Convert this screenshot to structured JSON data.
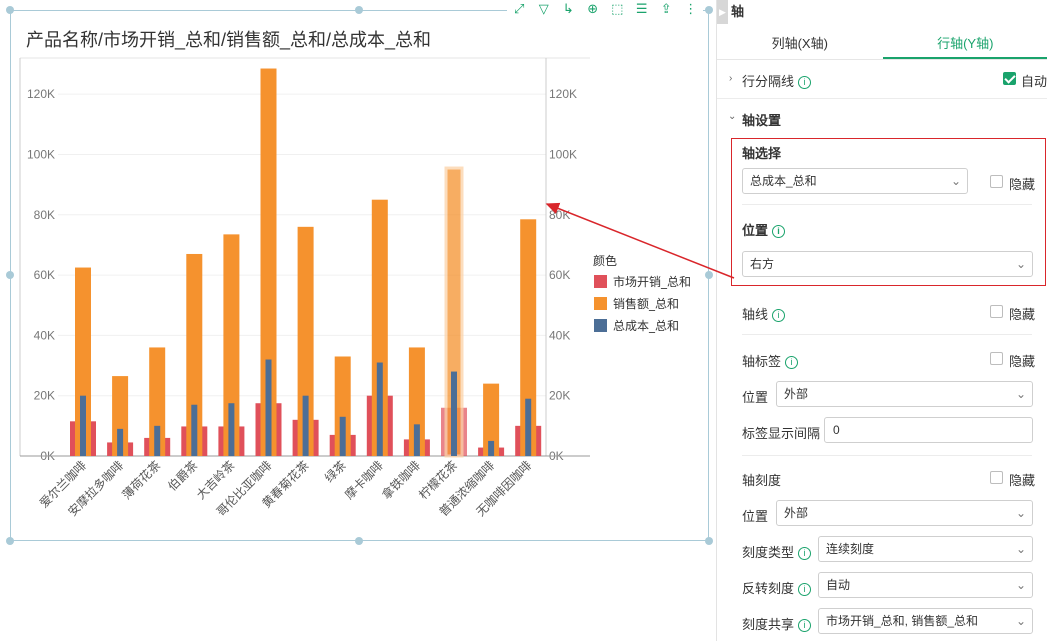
{
  "chart": {
    "title": "产品名称/市场开销_总和/销售额_总和/总成本_总和",
    "toolbar_icons": [
      "expand-icon",
      "filter-icon",
      "drill-icon",
      "zoom-icon",
      "select-icon",
      "list-icon",
      "export-icon",
      "more-icon"
    ]
  },
  "chart_data": {
    "type": "bar",
    "title": "产品名称/市场开销_总和/销售额_总和/总成本_总和",
    "categories": [
      "爱尔兰咖啡",
      "安摩拉多咖啡",
      "薄荷花茶",
      "伯爵茶",
      "大吉岭茶",
      "哥伦比亚咖啡",
      "黄春菊花茶",
      "绿茶",
      "摩卡咖啡",
      "拿铁咖啡",
      "柠檬花茶",
      "普通浓缩咖啡",
      "无咖啡因咖啡"
    ],
    "series": [
      {
        "name": "市场开销_总和",
        "color": "#e0505a",
        "values": [
          11500,
          4500,
          6000,
          9800,
          9800,
          17500,
          12000,
          7000,
          20000,
          5500,
          16000,
          2800,
          10000
        ]
      },
      {
        "name": "销售额_总和",
        "color": "#f5922e",
        "values": [
          62500,
          26500,
          36000,
          67000,
          73500,
          128500,
          76000,
          33000,
          85000,
          36000,
          95500,
          24000,
          78500
        ]
      },
      {
        "name": "总成本_总和",
        "color": "#4c6e96",
        "values": [
          20000,
          9000,
          10000,
          17000,
          17500,
          32000,
          20000,
          13000,
          31000,
          10500,
          28000,
          5000,
          19000
        ]
      }
    ],
    "yticks": [
      "0K",
      "20K",
      "40K",
      "60K",
      "80K",
      "100K",
      "120K"
    ],
    "ylim": [
      0,
      130000
    ],
    "legend_title": "颜色",
    "legend_position": "right",
    "highlighted_category": "柠檬花茶"
  },
  "panel": {
    "header": "轴",
    "tabs": [
      {
        "label": "列轴(X轴)"
      },
      {
        "label": "行轴(Y轴)"
      }
    ],
    "row_gridline": {
      "label": "行分隔线",
      "auto_label": "自动"
    },
    "axis_settings": {
      "label": "轴设置"
    },
    "axis_select": {
      "label": "轴选择",
      "value": "总成本_总和",
      "hide_label": "隐藏"
    },
    "position": {
      "label": "位置",
      "value": "右方"
    },
    "axis_line": {
      "label": "轴线",
      "hide_label": "隐藏"
    },
    "axis_label": {
      "label": "轴标签",
      "hide_label": "隐藏",
      "position_label": "位置",
      "position_value": "外部",
      "interval_label": "标签显示间隔",
      "interval_value": "0"
    },
    "axis_tick": {
      "label": "轴刻度",
      "hide_label": "隐藏",
      "position_label": "位置",
      "position_value": "外部",
      "type_label": "刻度类型",
      "type_value": "连续刻度",
      "reverse_label": "反转刻度",
      "reverse_value": "自动",
      "share_label": "刻度共享",
      "share_value": "市场开销_总和, 销售额_总和"
    }
  }
}
